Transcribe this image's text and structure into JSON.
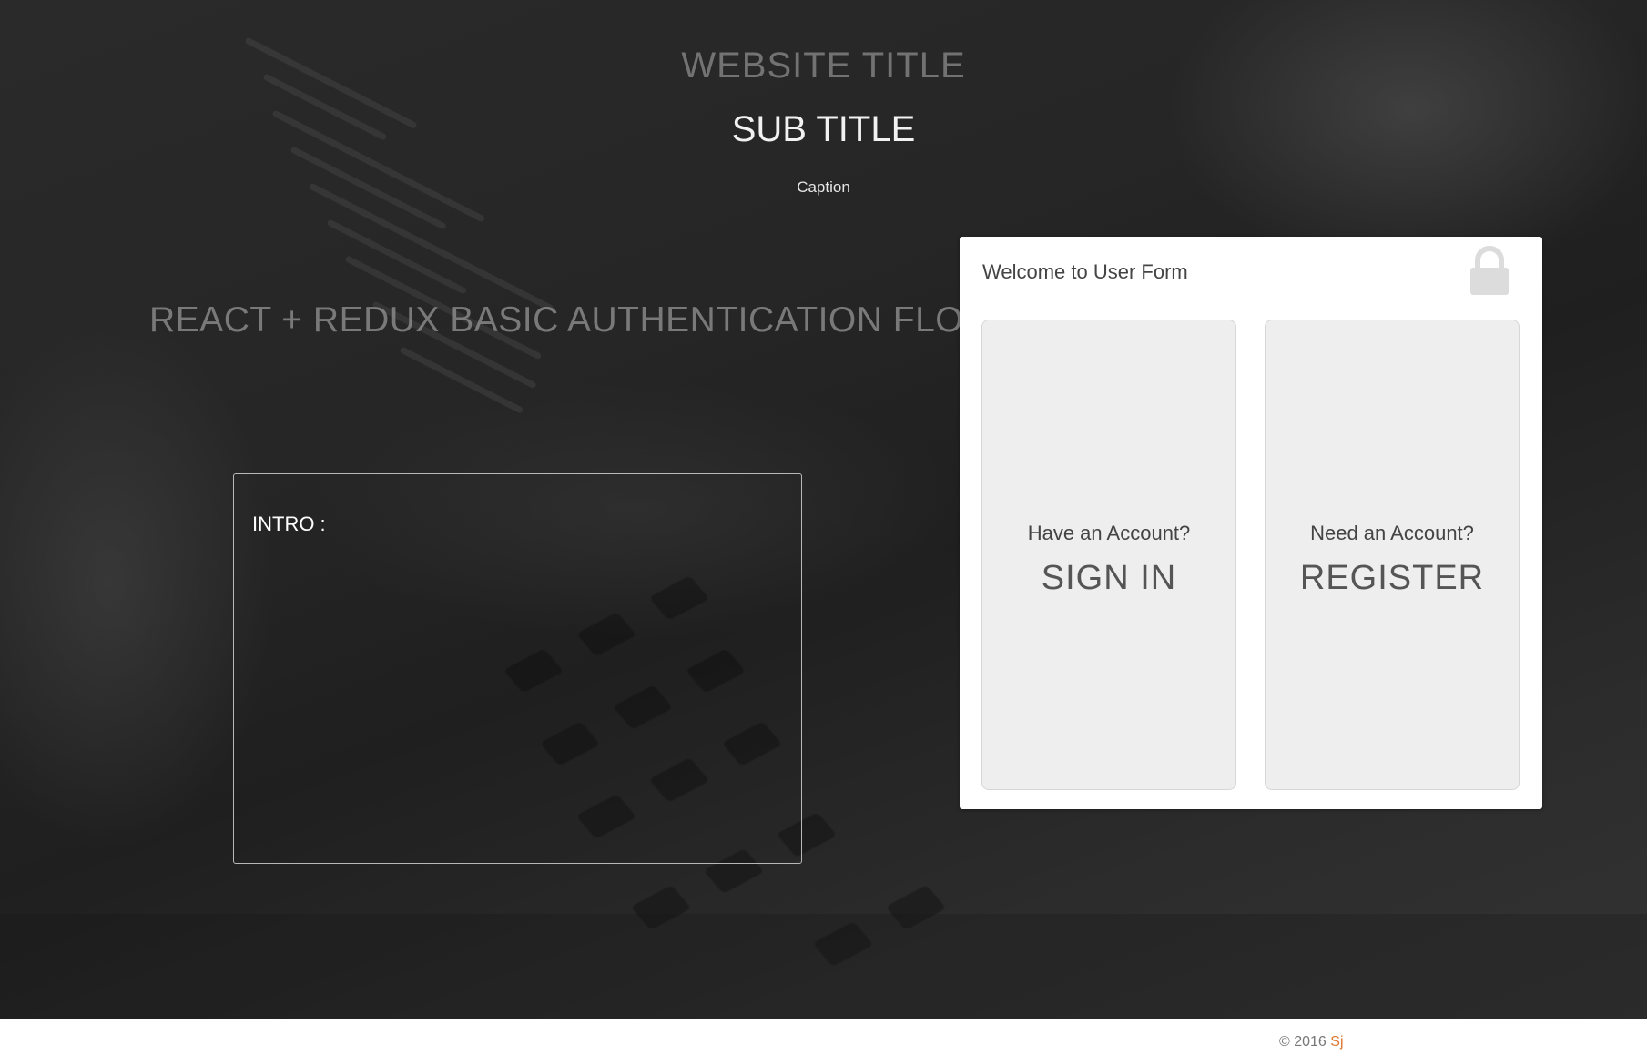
{
  "header": {
    "website_title": "WEBSITE TITLE",
    "sub_title": "SUB TITLE",
    "caption": "Caption"
  },
  "main": {
    "flow_heading": "REACT + REDUX BASIC AUTHENTICATION FLOW",
    "intro_label": "INTRO :"
  },
  "user_form": {
    "title": "Welcome to User Form",
    "icon": "lock-icon",
    "sign_in": {
      "question": "Have an Account?",
      "action": "SIGN IN"
    },
    "register": {
      "question": "Need an Account?",
      "action": "REGISTER"
    }
  },
  "footer": {
    "copyright": "© 2016",
    "author": "Sj"
  },
  "colors": {
    "background": "#262626",
    "card": "#ffffff",
    "choice_tile": "#eeeeee",
    "author_accent": "#e0762e"
  }
}
